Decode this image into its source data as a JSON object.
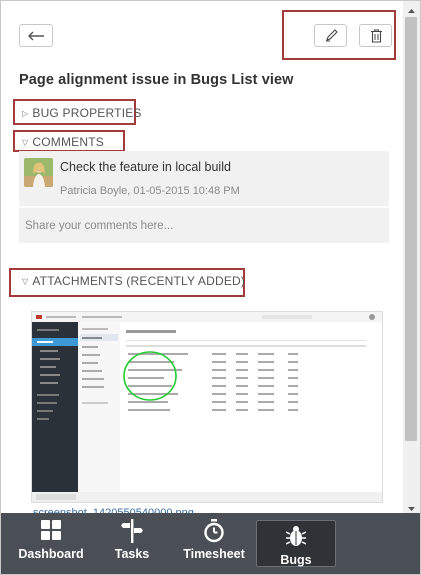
{
  "title": "Page alignment issue in Bugs List view",
  "sections": {
    "bug_properties": "BUG PROPERTIES",
    "comments": "COMMENTS",
    "attachments": "ATTACHMENTS (RECENTLY ADDED)"
  },
  "comment": {
    "text": "Check the feature in local build",
    "author_date": "Patricia Boyle, 01-05-2015 10:48 PM"
  },
  "share_placeholder": "Share your comments here...",
  "attachment": {
    "filename": "screenshot_1420550540000.png"
  },
  "nav": {
    "items": [
      {
        "label": "Dashboard",
        "icon": "dashboard-grid-icon"
      },
      {
        "label": "Tasks",
        "icon": "tasks-signpost-icon"
      },
      {
        "label": "Timesheet",
        "icon": "stopwatch-icon"
      },
      {
        "label": "Bugs",
        "icon": "bug-icon"
      }
    ],
    "active": "Bugs"
  },
  "colors": {
    "highlight": "#a33b3b",
    "nav_bg": "#4a4f56",
    "nav_active": "#2f3236",
    "comment_bg": "#f1f1f1",
    "link": "#3a6ea5"
  }
}
